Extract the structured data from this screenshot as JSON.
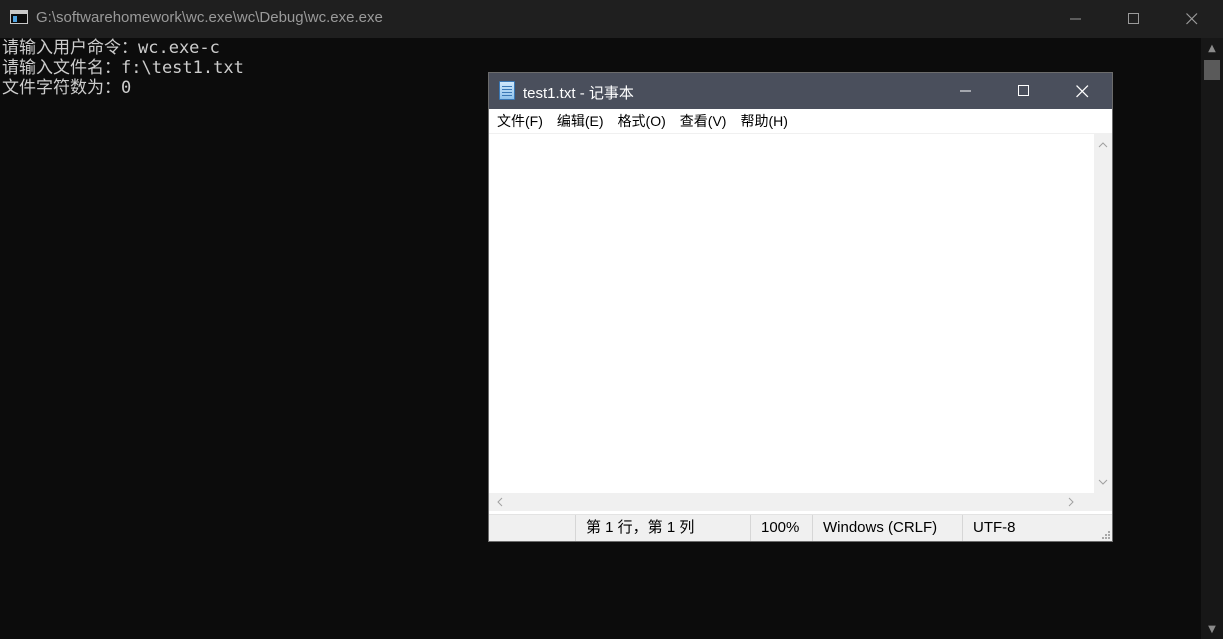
{
  "console": {
    "title": "G:\\softwarehomework\\wc.exe\\wc\\Debug\\wc.exe.exe",
    "lines": [
      "请输入用户命令：wc.exe-c",
      "请输入文件名：f:\\test1.txt",
      "文件字符数为：0"
    ]
  },
  "notepad": {
    "title": "test1.txt - 记事本",
    "menu": [
      "文件(F)",
      "编辑(E)",
      "格式(O)",
      "查看(V)",
      "帮助(H)"
    ],
    "content": "",
    "status": {
      "position": "第 1 行，第 1 列",
      "zoom": "100%",
      "line_ending": "Windows (CRLF)",
      "encoding": "UTF-8"
    }
  },
  "icons": {
    "console_app": "console-app-icon",
    "notepad_app": "notepad-app-icon",
    "minimize": "minimize-icon",
    "maximize": "maximize-icon",
    "close": "close-icon"
  },
  "colors": {
    "console_bg": "#0c0c0c",
    "console_text": "#cccccc",
    "notepad_titlebar": "#4a4f5c"
  }
}
